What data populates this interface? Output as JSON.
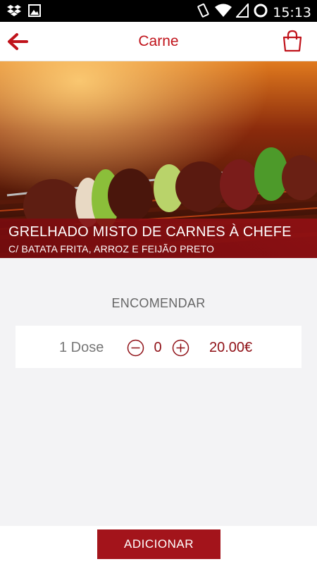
{
  "status_bar": {
    "time": "15:13",
    "icons_left": [
      "dropbox-icon",
      "image-icon"
    ],
    "icons_right": [
      "vibrate-icon",
      "wifi-icon",
      "signal-icon",
      "sync-icon"
    ]
  },
  "app_bar": {
    "title": "Carne",
    "back_icon": "arrow-left-icon",
    "cart_icon": "shopping-bag-icon",
    "accent_color": "#c0131b"
  },
  "product": {
    "name": "GRELHADO MISTO DE CARNES À CHEFE",
    "description": "C/ BATATA FRITA, ARROZ E FEIJÃO PRETO"
  },
  "order": {
    "section_label": "ENCOMENDAR",
    "portion_label": "1 Dose",
    "quantity": "0",
    "price": "20.00€",
    "decrement_icon": "minus-circle-icon",
    "increment_icon": "plus-circle-icon"
  },
  "footer": {
    "add_button_label": "ADICIONAR",
    "button_color": "#a3141b"
  }
}
